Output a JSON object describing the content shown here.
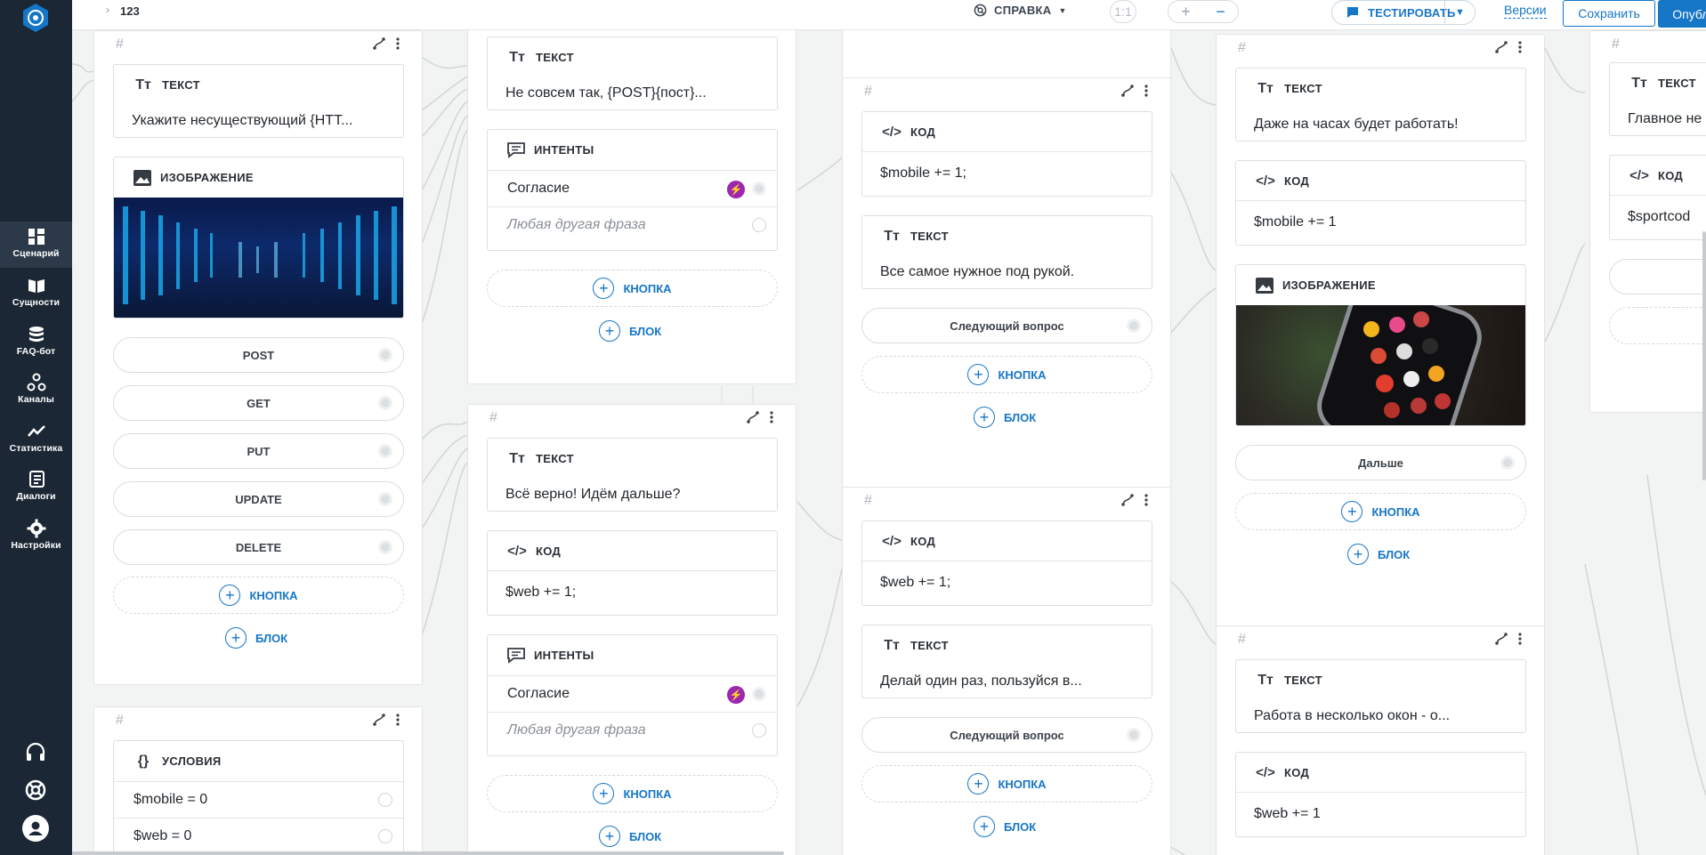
{
  "app": {
    "breadcrumb": "123"
  },
  "sidebar": {
    "items": [
      {
        "label": "Сценарий",
        "icon": "scenario-icon"
      },
      {
        "label": "Сущности",
        "icon": "book-icon"
      },
      {
        "label": "FAQ-бот",
        "icon": "database-icon"
      },
      {
        "label": "Каналы",
        "icon": "channels-icon"
      },
      {
        "label": "Статистика",
        "icon": "chart-line-icon"
      },
      {
        "label": "Диалоги",
        "icon": "dialogs-icon"
      },
      {
        "label": "Настройки",
        "icon": "gear-icon"
      }
    ],
    "bottom_icons": [
      "headset-icon",
      "lifebuoy-icon",
      "user-avatar-icon"
    ]
  },
  "topbar": {
    "help": "СПРАВКА",
    "zoom_reset": "1:1",
    "zoom_in": "+",
    "zoom_out": "−",
    "test": "ТЕСТИРОВАТЬ",
    "versions": "Версии",
    "save": "Сохранить",
    "publish": "Опубликовать"
  },
  "labels": {
    "text": "ТЕКСТ",
    "image": "ИЗОБРАЖЕНИЕ",
    "intents": "ИНТЕНТЫ",
    "code": "КОД",
    "conditions": "УСЛОВИЯ",
    "add_button": "КНОПКА",
    "add_block": "БЛОК",
    "hash": "#"
  },
  "screens": {
    "s1": {
      "text": "Укажите несуществующий {HTT...",
      "buttons": [
        "POST",
        "GET",
        "PUT",
        "UPDATE",
        "DELETE"
      ]
    },
    "s2": {
      "text": "Не совсем так, {POST}{пост}...",
      "intents": [
        "Согласие",
        "Любая другая фраза"
      ]
    },
    "s3": {
      "text": "Всё верно! Идём дальше?",
      "code": "$web += 1;",
      "intents": [
        "Согласие",
        "Любая другая фраза"
      ]
    },
    "s4": {
      "code": "$mobile += 1;",
      "text": "Все самое нужное под рукой.",
      "button": "Следующий вопрос"
    },
    "s5": {
      "code": "$web += 1;",
      "text": "Делай один раз, пользуйся в...",
      "button": "Следующий вопрос"
    },
    "s6": {
      "text": "Даже на часах будет работать!",
      "code": "$mobile += 1",
      "button": "Дальше"
    },
    "s7": {
      "text": "Работа в несколько окон - о...",
      "code": "$web += 1"
    },
    "s8": {
      "text": "Главное не",
      "code": "$sportcod"
    },
    "s9": {
      "conditions": [
        "$mobile = 0",
        "$web = 0"
      ]
    }
  }
}
